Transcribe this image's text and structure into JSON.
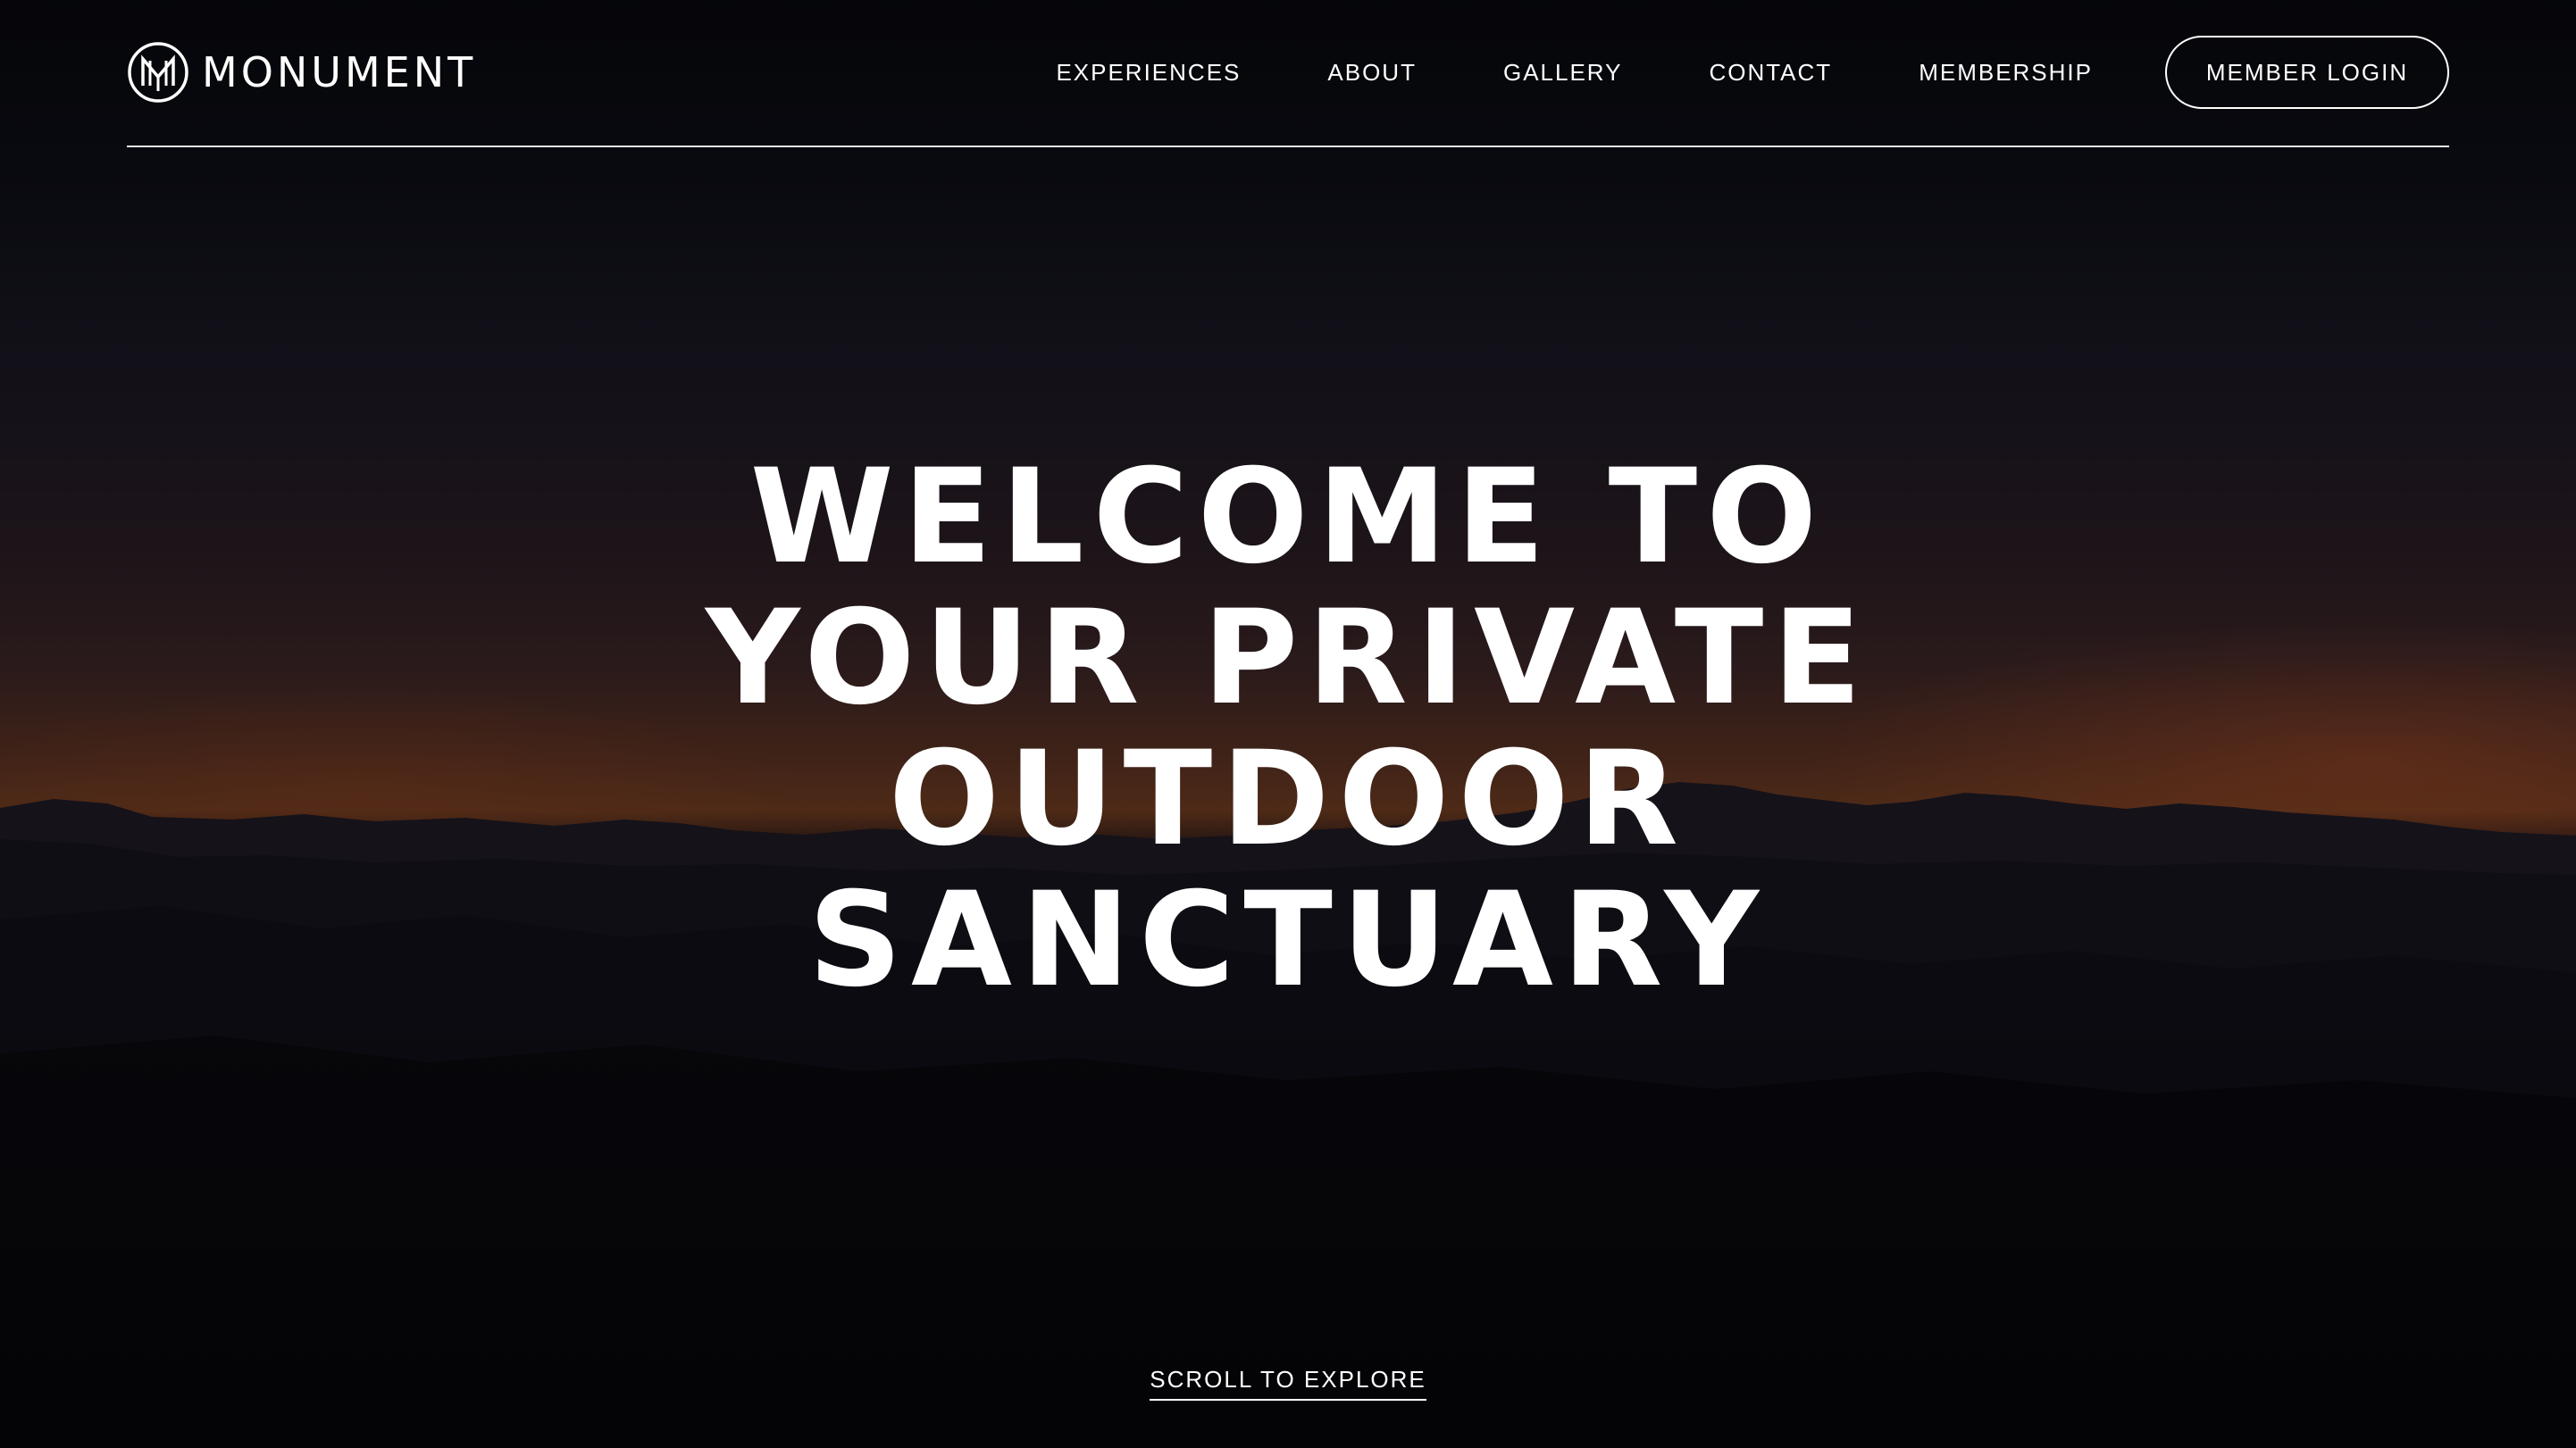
{
  "brand": {
    "name": "MONUMENT",
    "logo_icon": "monument-monogram-icon"
  },
  "nav": {
    "items": [
      {
        "label": "EXPERIENCES"
      },
      {
        "label": "ABOUT"
      },
      {
        "label": "GALLERY"
      },
      {
        "label": "CONTACT"
      },
      {
        "label": "MEMBERSHIP"
      }
    ],
    "login_label": "MEMBER LOGIN"
  },
  "hero": {
    "headline_lines": [
      "WELCOME TO",
      "YOUR PRIVATE",
      "OUTDOOR",
      "SANCTUARY"
    ],
    "scroll_label": "SCROLL TO EXPLORE"
  },
  "colors": {
    "text": "#ffffff",
    "background": "#06070b",
    "sunset_glow": "#4e2a17"
  }
}
